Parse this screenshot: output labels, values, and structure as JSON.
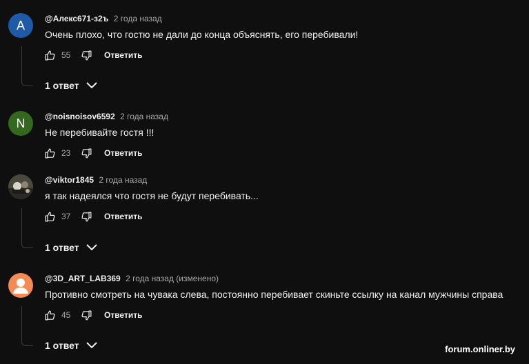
{
  "comments": [
    {
      "avatar_letter": "A",
      "avatar_color": "#1e5aa8",
      "author": "@Алекс671-з2ъ",
      "time": "2 года назад",
      "text": "Очень плохо, что гостю не дали до конца объяснять, его перебивали!",
      "likes": "55",
      "reply_label": "Ответить",
      "replies_label": "1 ответ"
    },
    {
      "avatar_letter": "N",
      "avatar_color": "#33691e",
      "author": "@noisnoisov6592",
      "time": "2 года назад",
      "text": "Не перебивайте гостя !!!",
      "likes": "23",
      "reply_label": "Ответить"
    },
    {
      "avatar_letter": "",
      "avatar_color": "#4a4a40",
      "author": "@viktor1845",
      "time": "2 года назад",
      "text": "я так надеялся что гостя не будут перебивать...",
      "likes": "37",
      "reply_label": "Ответить",
      "replies_label": "1 ответ"
    },
    {
      "avatar_letter": "",
      "avatar_color": "#f28b54",
      "author": "@3D_ART_LAB369",
      "time": "2 года назад (изменено)",
      "text": "Противно смотреть на чувака слева, постоянно перебивает скиньте ссылку на канал мужчины справа",
      "likes": "45",
      "reply_label": "Ответить",
      "replies_label": "1 ответ"
    }
  ],
  "watermark": "forum.onliner.by",
  "icons": {
    "like": "thumb-up-icon",
    "dislike": "thumb-down-icon",
    "chevron": "chevron-down-icon",
    "default_avatar": "person-icon"
  }
}
